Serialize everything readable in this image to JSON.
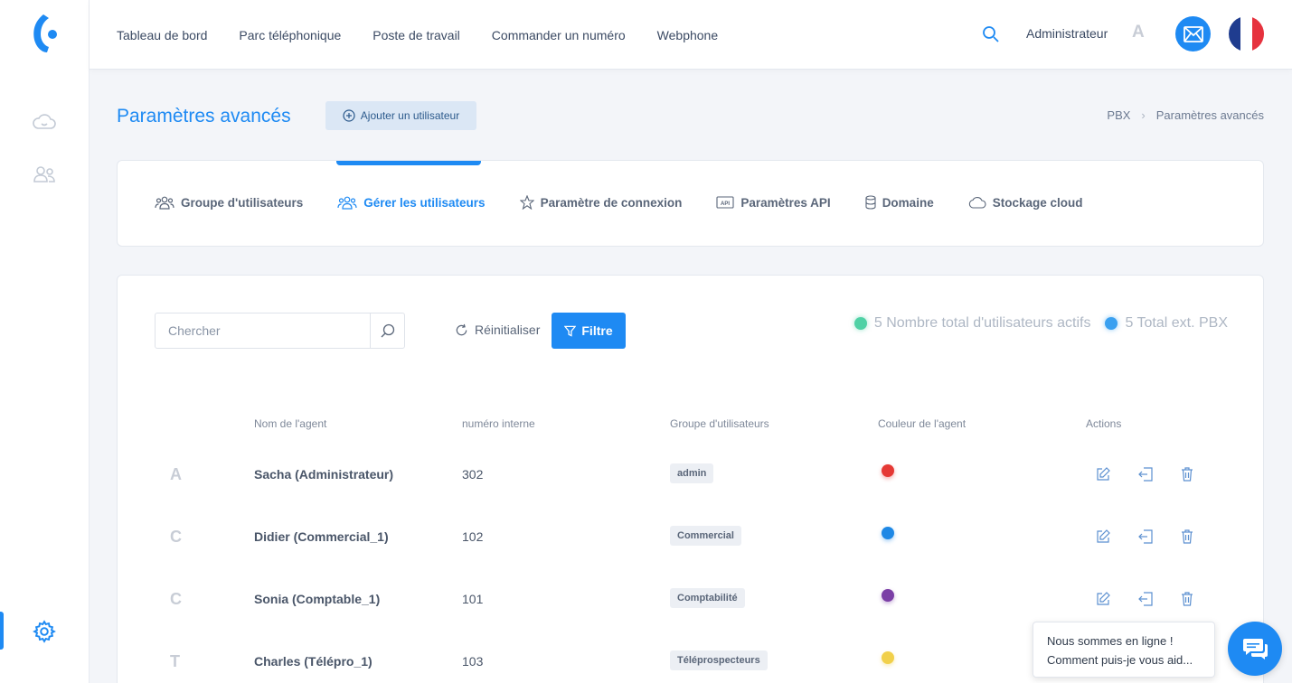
{
  "nav": [
    "Tableau de bord",
    "Parc téléphonique",
    "Poste de travail",
    "Commander un numéro",
    "Webphone"
  ],
  "header": {
    "admin_name": "Administrateur",
    "admin_initial": "A"
  },
  "page": {
    "title": "Paramètres avancés",
    "add_user_label": "Ajouter un utilisateur",
    "breadcrumb": [
      "PBX",
      "Paramètres avancés"
    ]
  },
  "tabs": [
    {
      "label": "Groupe d'utilisateurs",
      "icon": "users-icon"
    },
    {
      "label": "Gérer les utilisateurs",
      "icon": "users-icon",
      "active": true
    },
    {
      "label": "Paramètre de connexion",
      "icon": "star-icon"
    },
    {
      "label": "Paramètres API",
      "icon": "api-icon"
    },
    {
      "label": "Domaine",
      "icon": "database-icon"
    },
    {
      "label": "Stockage cloud",
      "icon": "cloud-icon"
    }
  ],
  "filters": {
    "search_placeholder": "Chercher",
    "reset_label": "Réinitialiser",
    "filter_label": "Filtre"
  },
  "stats": {
    "active_users": "5 Nombre total d'utilisateurs actifs",
    "pbx_ext": "5 Total ext. PBX",
    "active_color": "#4fd1a5",
    "pbx_color": "#3aa0f0"
  },
  "table": {
    "headers": [
      "Nom de l'agent",
      "numéro interne",
      "Groupe d'utilisateurs",
      "Couleur de l'agent",
      "Actions"
    ],
    "rows": [
      {
        "initial": "A",
        "agent": "Sacha (Administrateur)",
        "number": "302",
        "group": "admin",
        "color": "#e53935"
      },
      {
        "initial": "C",
        "agent": "Didier (Commercial_1)",
        "number": "102",
        "group": "Commercial",
        "color": "#1e88e5"
      },
      {
        "initial": "C",
        "agent": "Sonia (Comptable_1)",
        "number": "101",
        "group": "Comptabilité",
        "color": "#7b3fa6"
      },
      {
        "initial": "T",
        "agent": "Charles (Télépro_1)",
        "number": "103",
        "group": "Téléprospecteurs",
        "color": "#f1d04b"
      }
    ]
  },
  "chat": {
    "title": "Nous sommes en ligne !",
    "subtitle": "Comment puis-je vous aid..."
  }
}
